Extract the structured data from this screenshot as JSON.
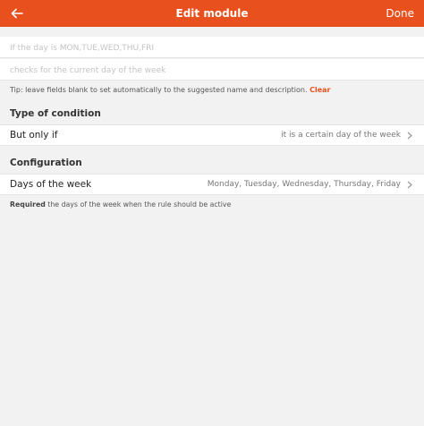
{
  "header": {
    "title": "Edit module",
    "done_label": "Done",
    "background_color": "#e8501e"
  },
  "form": {
    "name_placeholder": "If the day is MON,TUE,WED,THU,FRI",
    "name_value": "",
    "description_placeholder": "checks for the current day of the week",
    "description_value": "",
    "tip_text": "Tip: leave fields blank to set automatically to the suggested name and description.",
    "tip_link": "Clear"
  },
  "type_section": {
    "heading": "Type of condition",
    "row_label": "But only if",
    "row_value": "it is a certain day of the week"
  },
  "config_section": {
    "heading": "Configuration",
    "row_label": "Days of the week",
    "row_value": "Monday, Tuesday, Wednesday, Thursday, Friday",
    "required_label": "Required",
    "required_text": "the days of the week when the rule should be active"
  },
  "icons": {
    "back": "arrow-left-icon",
    "chevron": "chevron-right-icon"
  }
}
